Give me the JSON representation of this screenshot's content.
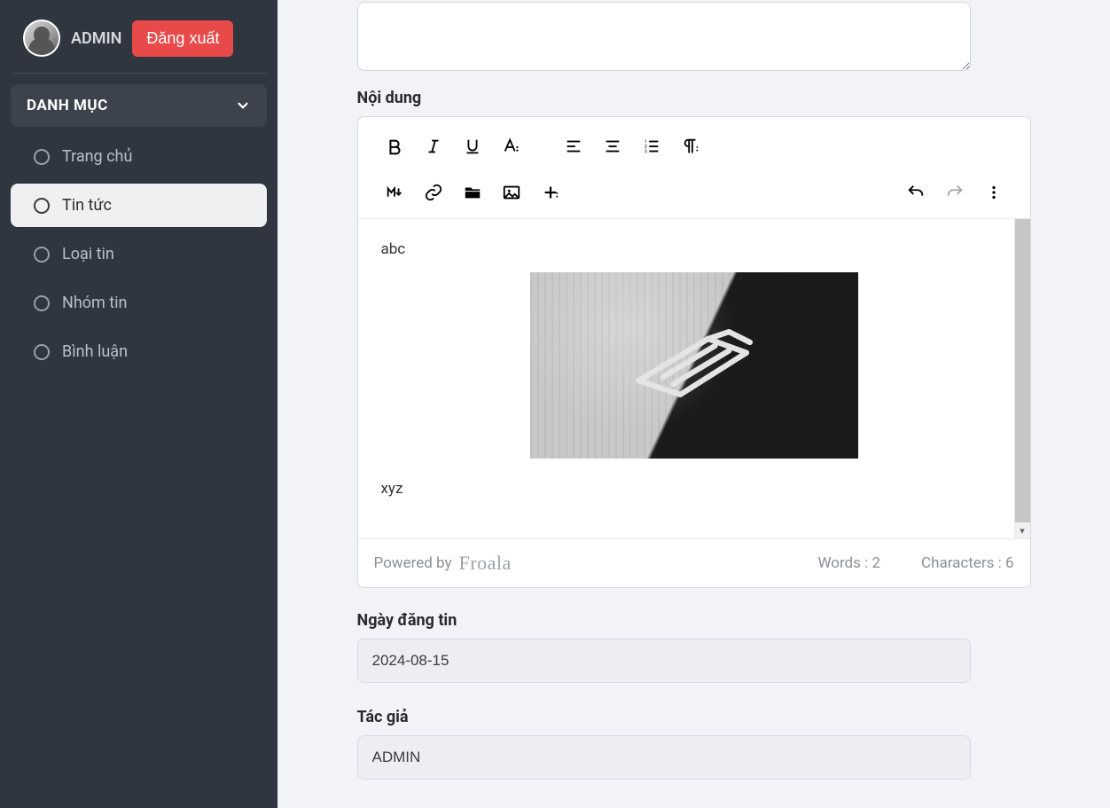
{
  "sidebar": {
    "user_label": "ADMIN",
    "logout_label": "Đăng xuất",
    "section_title": "DANH MỤC",
    "items": [
      {
        "label": "Trang chủ",
        "active": false
      },
      {
        "label": "Tin tức",
        "active": true
      },
      {
        "label": "Loại tin",
        "active": false
      },
      {
        "label": "Nhóm tin",
        "active": false
      },
      {
        "label": "Bình luận",
        "active": false
      }
    ]
  },
  "form": {
    "summary_value": "",
    "content_label": "Nội dung",
    "editor_text_top": "abc",
    "editor_text_bottom": "xyz",
    "powered_by": "Powered by",
    "brand": "Froala",
    "words_label": "Words : 2",
    "chars_label": "Characters : 6",
    "date_label": "Ngày đăng tin",
    "date_value": "2024-08-15",
    "author_label": "Tác giả",
    "author_value": "ADMIN"
  },
  "toolbar": {
    "row1": [
      "bold",
      "italic",
      "underline",
      "font-style",
      "align-left",
      "align-center",
      "list-ol",
      "paragraph-format"
    ],
    "row2": [
      "markdown",
      "link",
      "files",
      "image",
      "insert-more"
    ],
    "right": [
      "undo",
      "redo",
      "more"
    ]
  }
}
